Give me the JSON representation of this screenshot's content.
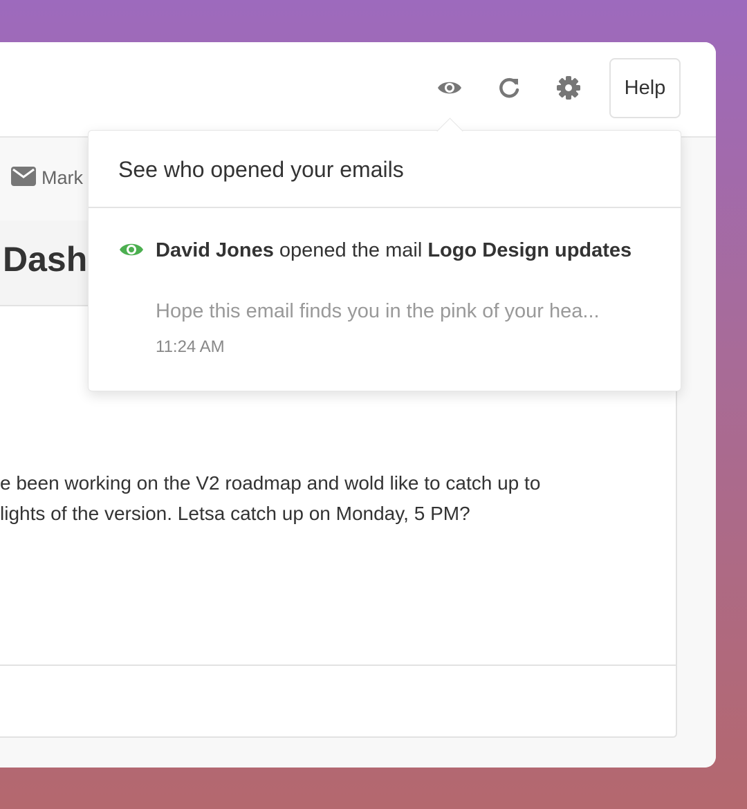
{
  "toolbar": {
    "eye_icon": "eye-icon",
    "refresh_icon": "refresh-icon",
    "settings_icon": "gear-icon",
    "help_label": "Help"
  },
  "left": {
    "mark_label": "Mark",
    "page_title": "Dash"
  },
  "message": {
    "line1": "e been working on the V2 roadmap and wold like to catch up to",
    "line2": "lights of the version. Letsa catch up on Monday, 5 PM?"
  },
  "popover": {
    "title": "See who opened your emails",
    "notification": {
      "person": "David Jones",
      "action": "opened the mail",
      "subject": "Logo Design updates",
      "preview": "Hope this email finds you in the pink of your hea...",
      "time": "11:24 AM"
    }
  },
  "colors": {
    "accent_green": "#4caf50",
    "icon_gray": "#777777",
    "background_gradient_top": "#9d6abd",
    "background_gradient_bottom": "#b4686e"
  }
}
